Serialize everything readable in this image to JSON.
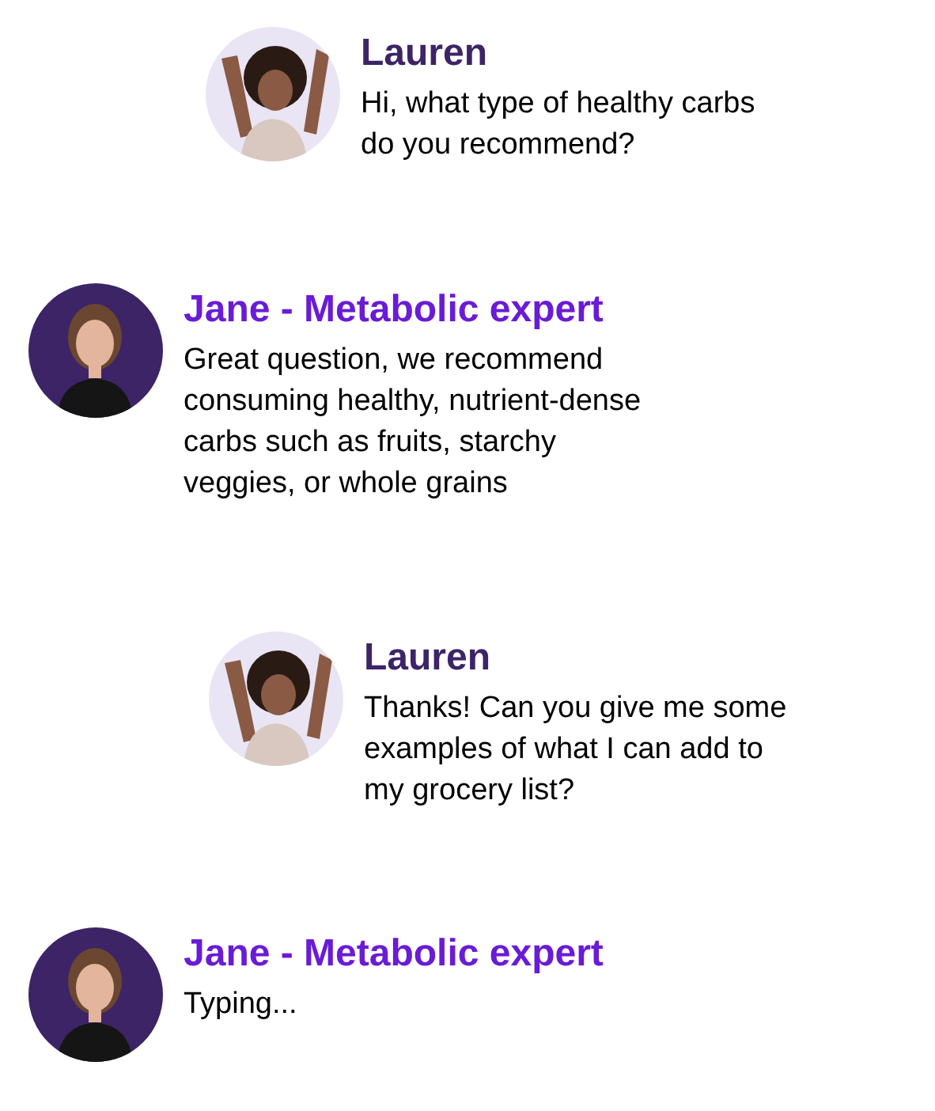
{
  "messages": [
    {
      "sender": "Lauren",
      "kind": "user",
      "text": "Hi, what type of healthy carbs do you recommend?"
    },
    {
      "sender": "Jane - Metabolic expert",
      "kind": "expert",
      "text": "Great question, we recommend consuming healthy, nutrient-dense carbs such as fruits, starchy veggies, or whole grains"
    },
    {
      "sender": "Lauren",
      "kind": "user",
      "text": "Thanks! Can you give me some examples of what I can add to my grocery list?"
    },
    {
      "sender": "Jane - Metabolic expert",
      "kind": "expert",
      "text": "Typing..."
    }
  ]
}
